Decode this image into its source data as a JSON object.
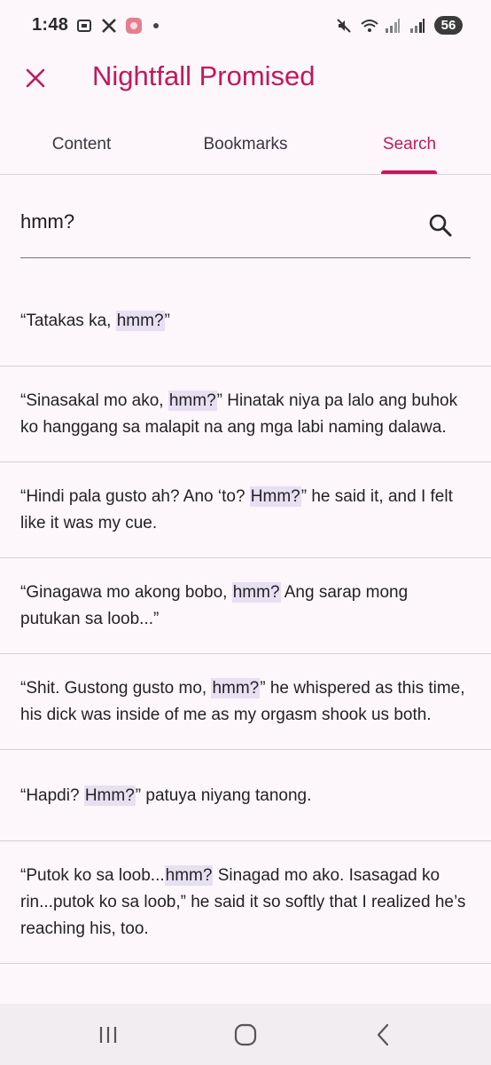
{
  "status_bar": {
    "time": "1:48",
    "icons_left": [
      "screenshot-icon",
      "x-app-icon",
      "app-icon",
      "dot-icon"
    ],
    "icons_right": [
      "mute-icon",
      "wifi-icon",
      "signal-icon",
      "signal-icon"
    ],
    "battery": "56"
  },
  "app_bar": {
    "title": "Nightfall Promised",
    "close_icon": "close-icon",
    "accent_color": "#c2185b"
  },
  "tabs": [
    {
      "label": "Content",
      "selected": false
    },
    {
      "label": "Bookmarks",
      "selected": false
    },
    {
      "label": "Search",
      "selected": true
    }
  ],
  "search": {
    "value": "hmm?",
    "icon": "search-icon"
  },
  "results": [
    {
      "before": "“Tatakas ka, ",
      "match": "hmm?",
      "after": "”"
    },
    {
      "before": "“Sinasakal mo ako, ",
      "match": "hmm?",
      "after": "” Hinatak niya pa lalo ang buhok ko hanggang sa malapit na ang mga labi naming dalawa."
    },
    {
      "before": "“Hindi pala gusto ah? Ano ‘to? ",
      "match": "Hmm?",
      "after": "” he said it, and I felt like it was my cue."
    },
    {
      "before": "“Ginagawa mo akong bobo, ",
      "match": "hmm?",
      "after": " Ang sarap mong putukan sa loob...”"
    },
    {
      "before": "“Shit. Gustong gusto mo, ",
      "match": "hmm?",
      "after": "” he whispered as this time, his dick was inside of me as my orgasm shook us both."
    },
    {
      "before": "“Hapdi? ",
      "match": "Hmm?",
      "after": "” patuya niyang tanong."
    },
    {
      "before": "“Putok ko sa loob...",
      "match": "hmm?",
      "after": " Sinagad mo ako. Isasagad ko rin...putok ko sa loob,” he said it so softly that I realized he’s reaching his, too."
    }
  ],
  "nav_bar": {
    "buttons": [
      "recents-icon",
      "home-icon",
      "back-icon"
    ]
  }
}
